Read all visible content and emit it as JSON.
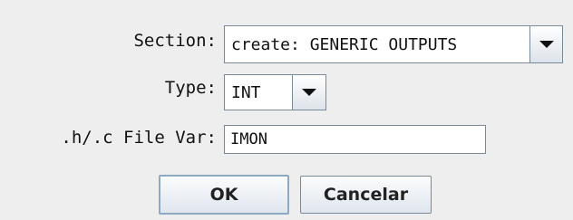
{
  "form": {
    "section": {
      "label": "Section:",
      "value": "create: GENERIC OUTPUTS"
    },
    "type": {
      "label": "Type:",
      "value": "INT"
    },
    "file_var": {
      "label": ".h/.c File Var:",
      "value": "IMON"
    }
  },
  "buttons": {
    "ok_label": "OK",
    "cancel_label": "Cancelar"
  },
  "icons": {
    "combo_arrow": "chevron-down-icon"
  },
  "colors": {
    "background": "#eeeeee",
    "border": "#7a8a99",
    "field_bg": "#ffffff",
    "default_button_border": "#8fa9c2"
  }
}
